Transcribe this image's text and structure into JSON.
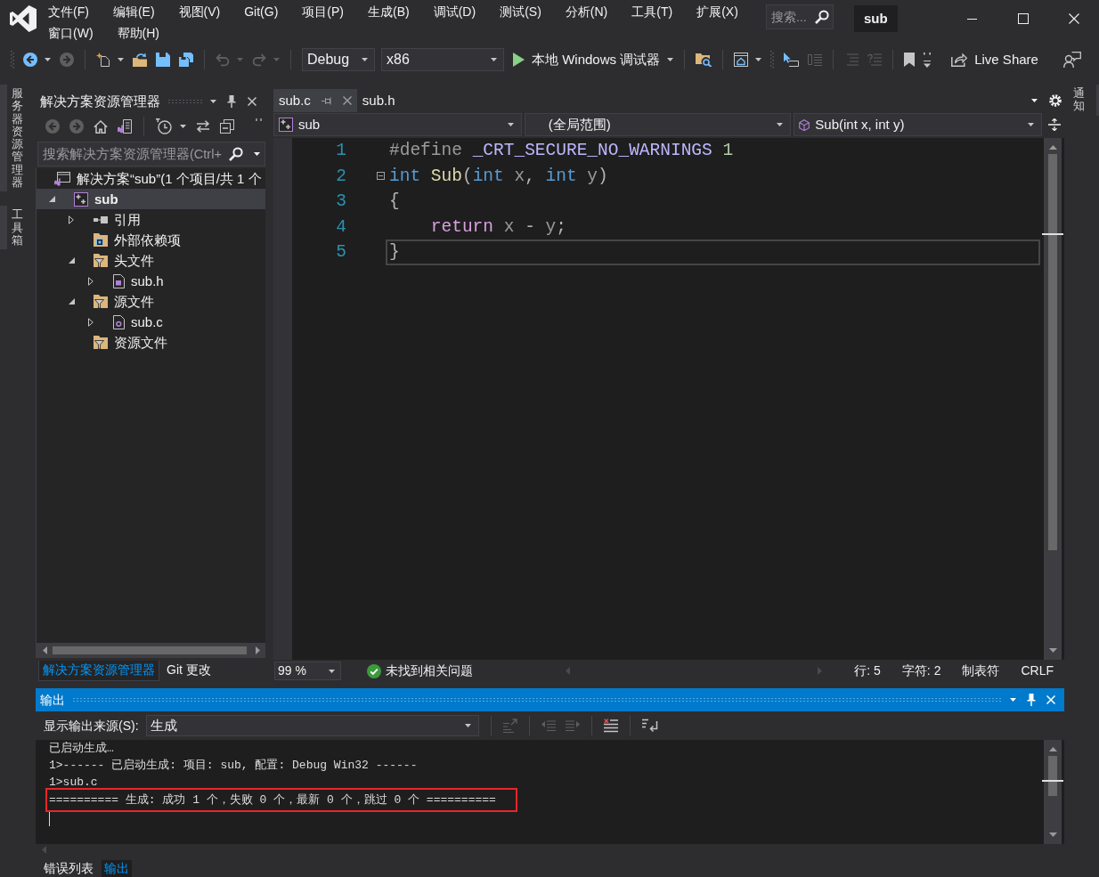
{
  "window": {
    "badge": "sub",
    "search": {
      "placeholder": "搜索..."
    }
  },
  "menu": [
    {
      "label": "文件(F)"
    },
    {
      "label": "编辑(E)"
    },
    {
      "label": "视图(V)"
    },
    {
      "label": "Git(G)"
    },
    {
      "label": "项目(P)"
    },
    {
      "label": "生成(B)"
    },
    {
      "label": "调试(D)"
    },
    {
      "label": "测试(S)"
    },
    {
      "label": "分析(N)"
    },
    {
      "label": "工具(T)"
    },
    {
      "label": "扩展(X)"
    },
    {
      "label": "窗口(W)"
    },
    {
      "label": "帮助(H)"
    }
  ],
  "toolbar": [
    {
      "kind": "grip"
    },
    {
      "kind": "back",
      "disabled": false,
      "dropdown": true
    },
    {
      "kind": "forward",
      "disabled": true
    },
    {
      "kind": "separator"
    },
    {
      "kind": "new-item",
      "disabled": false,
      "dropdown": true
    },
    {
      "kind": "open",
      "disabled": false
    },
    {
      "kind": "save",
      "disabled": false
    },
    {
      "kind": "save-all",
      "disabled": false
    },
    {
      "kind": "separator"
    },
    {
      "kind": "undo",
      "disabled": true,
      "dropdown": true
    },
    {
      "kind": "redo",
      "disabled": true,
      "dropdown": true
    },
    {
      "kind": "separator"
    },
    {
      "kind": "select",
      "label": "Debug",
      "disabled": false
    },
    {
      "kind": "select",
      "label": "x86",
      "disabled": false
    },
    {
      "kind": "run",
      "label": "本地 Windows 调试器",
      "disabled": false,
      "dropdown": true
    },
    {
      "kind": "separator"
    },
    {
      "kind": "find-folder",
      "disabled": false
    },
    {
      "kind": "separator"
    },
    {
      "kind": "browser",
      "disabled": false,
      "dropdown": true
    },
    {
      "kind": "grip"
    },
    {
      "kind": "pointer",
      "disabled": false
    },
    {
      "kind": "layout",
      "disabled": true
    },
    {
      "kind": "separator"
    },
    {
      "kind": "outdent",
      "disabled": true
    },
    {
      "kind": "comment",
      "disabled": true
    },
    {
      "kind": "separator"
    },
    {
      "kind": "bookmark",
      "disabled": false
    },
    {
      "kind": "overflow",
      "disabled": false
    },
    {
      "kind": "share",
      "label": "Live Share",
      "disabled": false
    },
    {
      "kind": "feedback",
      "disabled": false
    }
  ],
  "side_tabs_left": [
    {
      "label": "服务器资源管理器"
    },
    {
      "label": "工具箱"
    }
  ],
  "side_tabs_right": [
    {
      "label": "通知"
    }
  ],
  "solution_explorer": {
    "title": "解决方案资源管理器",
    "toolbar": [
      {
        "kind": "back",
        "disabled": true
      },
      {
        "kind": "forward",
        "disabled": true
      },
      {
        "kind": "home",
        "disabled": false
      },
      {
        "kind": "switch-views",
        "disabled": false
      },
      {
        "kind": "separator"
      },
      {
        "kind": "pending",
        "disabled": false,
        "dropdown": true
      },
      {
        "kind": "sync",
        "disabled": false
      },
      {
        "kind": "collapse",
        "disabled": false
      }
    ],
    "search": {
      "placeholder": "搜索解决方案资源管理器(Ctrl+"
    },
    "tree": [
      {
        "label": "解决方案“sub”(1 个项目/共 1 个",
        "kind": "solution",
        "selected": false,
        "children": [
          {
            "label": "sub",
            "kind": "project",
            "expanded": true,
            "selected": true,
            "children": [
              {
                "label": "引用",
                "kind": "references",
                "expanded": false,
                "selected": false
              },
              {
                "label": "外部依赖项",
                "kind": "external",
                "selected": false
              },
              {
                "label": "头文件",
                "kind": "filter",
                "expanded": true,
                "selected": false,
                "children": [
                  {
                    "label": "sub.h",
                    "kind": "header",
                    "expanded": false,
                    "selected": false
                  }
                ]
              },
              {
                "label": "源文件",
                "kind": "filter",
                "expanded": true,
                "selected": false,
                "children": [
                  {
                    "label": "sub.c",
                    "kind": "source",
                    "expanded": false,
                    "selected": false
                  }
                ]
              },
              {
                "label": "资源文件",
                "kind": "filter",
                "selected": false
              }
            ]
          }
        ]
      }
    ],
    "tabs": [
      {
        "label": "解决方案资源管理器",
        "selected": true
      },
      {
        "label": "Git 更改",
        "selected": false
      }
    ]
  },
  "editor": {
    "tabs": [
      {
        "label": "sub.c",
        "selected": true
      },
      {
        "label": "sub.h",
        "selected": false
      }
    ],
    "navigation": {
      "project": "sub",
      "scope": "(全局范围)",
      "member": "Sub(int x, int y)"
    },
    "lines": [
      {
        "number": "1",
        "current": false,
        "tokens": [
          {
            "text": "#define ",
            "kind": "preprocessor"
          },
          {
            "text": "_CRT_SECURE_NO_WARNINGS ",
            "kind": "macro"
          },
          {
            "text": "1",
            "kind": "number"
          }
        ]
      },
      {
        "number": "2",
        "current": false,
        "foldable": true,
        "tokens": [
          {
            "text": "int ",
            "kind": "keyword"
          },
          {
            "text": "Sub",
            "kind": "function"
          },
          {
            "text": "(",
            "kind": "punctuation"
          },
          {
            "text": "int ",
            "kind": "keyword"
          },
          {
            "text": "x",
            "kind": "parameter"
          },
          {
            "text": ", ",
            "kind": "punctuation"
          },
          {
            "text": "int ",
            "kind": "keyword"
          },
          {
            "text": "y",
            "kind": "parameter"
          },
          {
            "text": ")",
            "kind": "punctuation"
          }
        ]
      },
      {
        "number": "3",
        "current": false,
        "tokens": [
          {
            "text": "{",
            "kind": "punctuation"
          }
        ]
      },
      {
        "number": "4",
        "current": false,
        "tokens": [
          {
            "text": "    return ",
            "kind": "control"
          },
          {
            "text": "x",
            "kind": "parameter"
          },
          {
            "text": " - ",
            "kind": "punctuation"
          },
          {
            "text": "y",
            "kind": "parameter"
          },
          {
            "text": ";",
            "kind": "punctuation"
          }
        ]
      },
      {
        "number": "5",
        "current": true,
        "tokens": [
          {
            "text": "}",
            "kind": "punctuation"
          }
        ]
      }
    ],
    "status": {
      "zoom": "99 %",
      "issues": "未找到相关问题",
      "line": "行: 5",
      "column": "字符: 2",
      "indent": "制表符",
      "line_ending": "CRLF"
    }
  },
  "output": {
    "title": "输出",
    "source_label": "显示输出来源(S):",
    "source": "生成",
    "toolbar": [
      {
        "kind": "find-code",
        "disabled": true
      },
      {
        "kind": "separator"
      },
      {
        "kind": "previous",
        "disabled": true
      },
      {
        "kind": "next",
        "disabled": true
      },
      {
        "kind": "separator"
      },
      {
        "kind": "clear",
        "disabled": false
      },
      {
        "kind": "separator"
      },
      {
        "kind": "word-wrap",
        "disabled": false
      }
    ],
    "lines": [
      {
        "text": "已启动生成…",
        "highlighted": false
      },
      {
        "text": "1>------ 已启动生成: 项目: sub, 配置: Debug Win32 ------",
        "highlighted": false
      },
      {
        "text": "1>sub.c",
        "highlighted": false
      },
      {
        "text": "========== 生成: 成功 1 个，失败 0 个，最新 0 个，跳过 0 个 ==========",
        "highlighted": true
      }
    ]
  },
  "bottom_tabs": [
    {
      "label": "错误列表",
      "selected": false
    },
    {
      "label": "输出",
      "selected": true
    }
  ]
}
